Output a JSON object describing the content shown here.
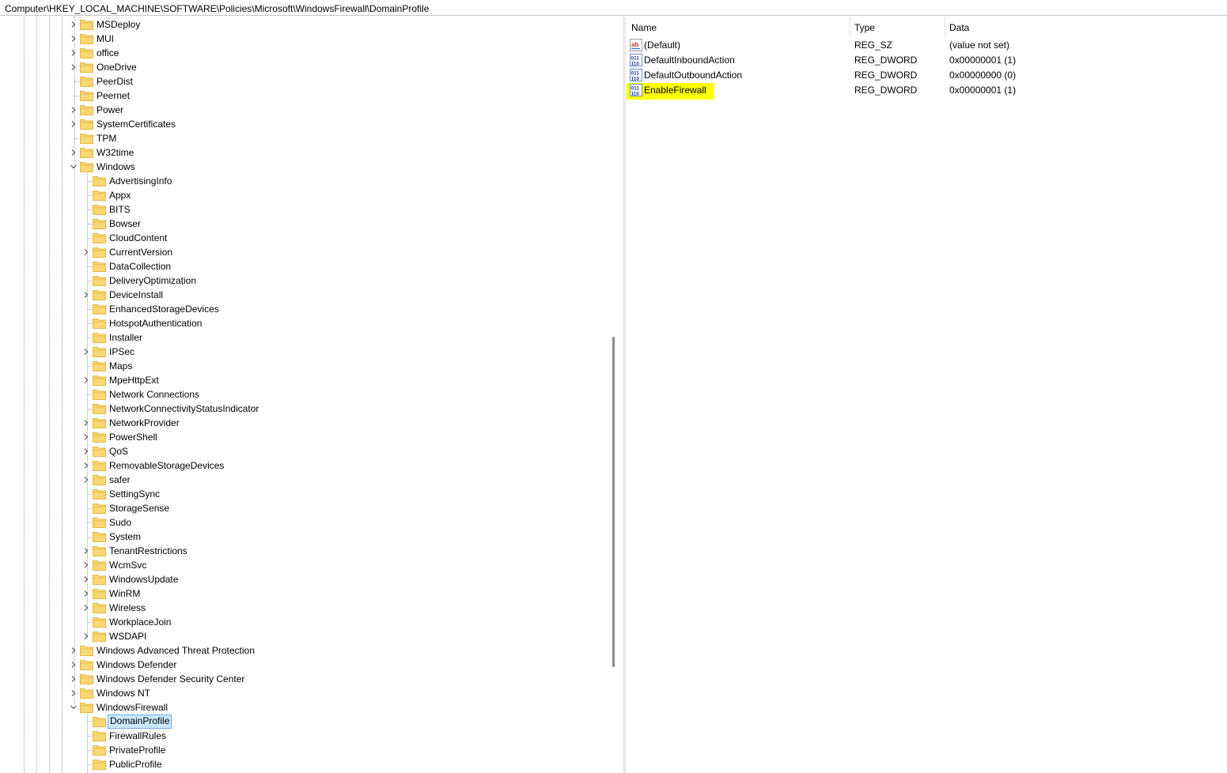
{
  "address_path": "Computer\\HKEY_LOCAL_MACHINE\\SOFTWARE\\Policies\\Microsoft\\WindowsFirewall\\DomainProfile",
  "colors": {
    "folder": "#f8d775",
    "folder_dark": "#e6b840",
    "selection": "#cce8ff",
    "highlight": "#ffff00"
  },
  "tree": {
    "policies_children": [
      {
        "label": "MSDeploy",
        "expander": "collapsed"
      },
      {
        "label": "MUI",
        "expander": "collapsed"
      },
      {
        "label": "office",
        "expander": "collapsed"
      },
      {
        "label": "OneDrive",
        "expander": "collapsed"
      },
      {
        "label": "PeerDist",
        "expander": "none"
      },
      {
        "label": "Peernet",
        "expander": "none"
      },
      {
        "label": "Power",
        "expander": "collapsed"
      },
      {
        "label": "SystemCertificates",
        "expander": "collapsed"
      },
      {
        "label": "TPM",
        "expander": "none"
      },
      {
        "label": "W32time",
        "expander": "collapsed"
      },
      {
        "label": "Windows",
        "expander": "expanded"
      }
    ],
    "windows_children": [
      {
        "label": "AdvertisingInfo",
        "expander": "none"
      },
      {
        "label": "Appx",
        "expander": "none"
      },
      {
        "label": "BITS",
        "expander": "none"
      },
      {
        "label": "Bowser",
        "expander": "none"
      },
      {
        "label": "CloudContent",
        "expander": "none"
      },
      {
        "label": "CurrentVersion",
        "expander": "collapsed"
      },
      {
        "label": "DataCollection",
        "expander": "none"
      },
      {
        "label": "DeliveryOptimization",
        "expander": "none"
      },
      {
        "label": "DeviceInstall",
        "expander": "collapsed"
      },
      {
        "label": "EnhancedStorageDevices",
        "expander": "none"
      },
      {
        "label": "HotspotAuthentication",
        "expander": "none"
      },
      {
        "label": "Installer",
        "expander": "none"
      },
      {
        "label": "IPSec",
        "expander": "collapsed"
      },
      {
        "label": "Maps",
        "expander": "none"
      },
      {
        "label": "MpeHttpExt",
        "expander": "collapsed"
      },
      {
        "label": "Network Connections",
        "expander": "none"
      },
      {
        "label": "NetworkConnectivityStatusIndicator",
        "expander": "none"
      },
      {
        "label": "NetworkProvider",
        "expander": "collapsed"
      },
      {
        "label": "PowerShell",
        "expander": "collapsed"
      },
      {
        "label": "QoS",
        "expander": "collapsed"
      },
      {
        "label": "RemovableStorageDevices",
        "expander": "collapsed"
      },
      {
        "label": "safer",
        "expander": "collapsed"
      },
      {
        "label": "SettingSync",
        "expander": "none"
      },
      {
        "label": "StorageSense",
        "expander": "none"
      },
      {
        "label": "Sudo",
        "expander": "none"
      },
      {
        "label": "System",
        "expander": "none"
      },
      {
        "label": "TenantRestrictions",
        "expander": "collapsed"
      },
      {
        "label": "WcmSvc",
        "expander": "collapsed"
      },
      {
        "label": "WindowsUpdate",
        "expander": "collapsed"
      },
      {
        "label": "WinRM",
        "expander": "collapsed"
      },
      {
        "label": "Wireless",
        "expander": "collapsed"
      },
      {
        "label": "WorkplaceJoin",
        "expander": "none"
      },
      {
        "label": "WSDAPI",
        "expander": "collapsed"
      }
    ],
    "policies_children_after": [
      {
        "label": "Windows Advanced Threat Protection",
        "expander": "collapsed"
      },
      {
        "label": "Windows Defender",
        "expander": "collapsed"
      },
      {
        "label": "Windows Defender Security Center",
        "expander": "collapsed"
      },
      {
        "label": "Windows NT",
        "expander": "collapsed"
      },
      {
        "label": "WindowsFirewall",
        "expander": "expanded"
      }
    ],
    "firewall_children": [
      {
        "label": "DomainProfile",
        "expander": "none",
        "selected": true
      },
      {
        "label": "FirewallRules",
        "expander": "none"
      },
      {
        "label": "PrivateProfile",
        "expander": "none"
      },
      {
        "label": "PublicProfile",
        "expander": "none"
      }
    ]
  },
  "list": {
    "columns": [
      "Name",
      "Type",
      "Data"
    ],
    "rows": [
      {
        "icon": "string-value-icon",
        "name": "(Default)",
        "type": "REG_SZ",
        "data": "(value not set)",
        "highlight": false
      },
      {
        "icon": "dword-value-icon",
        "name": "DefaultInboundAction",
        "type": "REG_DWORD",
        "data": "0x00000001 (1)",
        "highlight": false
      },
      {
        "icon": "dword-value-icon",
        "name": "DefaultOutboundAction",
        "type": "REG_DWORD",
        "data": "0x00000000 (0)",
        "highlight": false
      },
      {
        "icon": "dword-value-icon",
        "name": "EnableFirewall",
        "type": "REG_DWORD",
        "data": "0x00000001 (1)",
        "highlight": true
      }
    ]
  }
}
